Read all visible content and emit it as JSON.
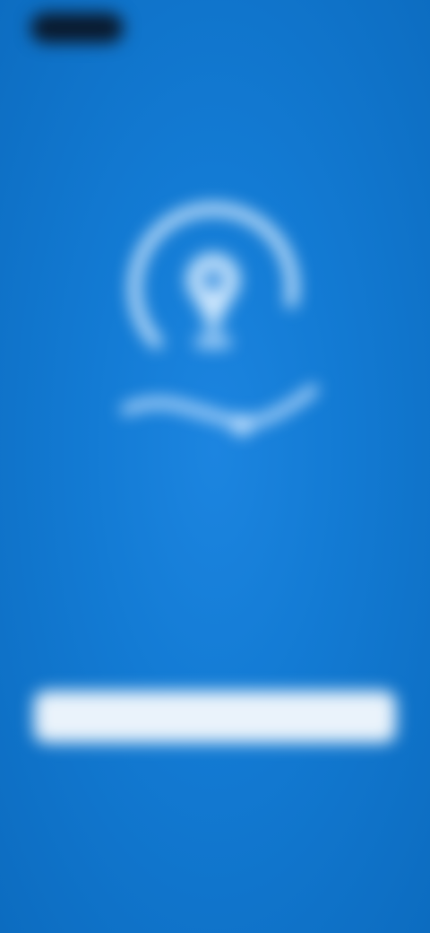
{
  "screen": {
    "title": "",
    "description": "",
    "step_indicator": "",
    "primary_button_label": "",
    "secondary_text": "",
    "footer_link_label": ""
  },
  "icons": {
    "illustration": "location-pin-with-arc-icon",
    "status": "status-bar-pill"
  },
  "colors": {
    "background": "#137bd4",
    "button": "#eaf3fb",
    "status_pill": "#0a1a2e"
  }
}
